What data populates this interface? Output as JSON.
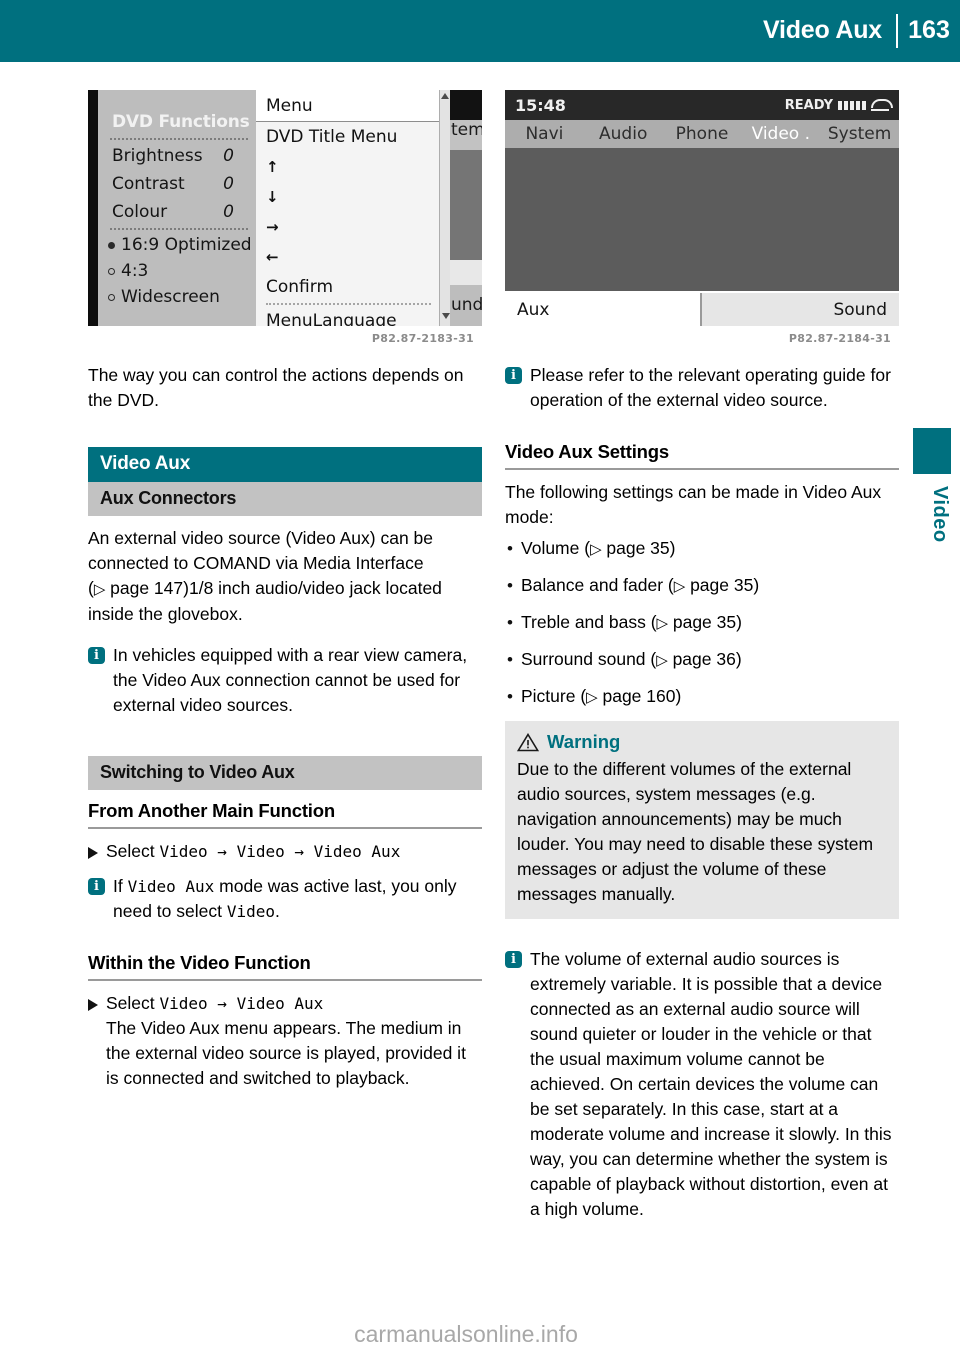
{
  "header": {
    "title": "Video Aux",
    "page_number": "163"
  },
  "edge_tab": {
    "label": "Video",
    "color": "#00707f"
  },
  "figures": {
    "left": {
      "caption": "P82.87-2183-31",
      "left_panel": {
        "title": "DVD Functions",
        "rows": [
          {
            "label": "Brightness",
            "value": "0"
          },
          {
            "label": "Contrast",
            "value": "0"
          },
          {
            "label": "Colour",
            "value": "0"
          }
        ],
        "options": [
          {
            "label": "16:9 Optimized",
            "selected": true
          },
          {
            "label": "4:3",
            "selected": false
          },
          {
            "label": "Widescreen",
            "selected": false
          }
        ]
      },
      "menu_panel": {
        "header": "Menu",
        "items": [
          "DVD Title Menu",
          "↑",
          "↓",
          "→",
          "←",
          "Confirm",
          "MenuLanguage"
        ]
      },
      "right_edge": {
        "top_label": "tem",
        "bottom_label": "und"
      }
    },
    "right": {
      "caption": "P82.87-2184-31",
      "status": {
        "time": "15:48",
        "ready_label": "READY",
        "signal_bars": 5
      },
      "menu_items": [
        "Navi",
        "Audio",
        "Phone",
        "Video .",
        "System"
      ],
      "active_menu_item": "Video .",
      "footer_left": "Aux",
      "footer_right": "Sound"
    }
  },
  "left_column": {
    "intro": "The way you can control the actions depends on the DVD.",
    "section_bar": "Video Aux",
    "subsection_bar": "Aux Connectors",
    "aux_connectors_text_1": "An external video source (Video Aux) can be connected to COMAND via Media Interface (",
    "aux_connectors_ref": "page 147",
    "aux_connectors_text_2": ")1/8 inch audio/video jack located inside the glovebox.",
    "note_1": "In vehicles equipped with a rear view camera, the Video Aux connection cannot be used for external video sources.",
    "switching_bar": "Switching to Video Aux",
    "heading_from_another": "From Another Main Function",
    "step_1_prefix": "Select ",
    "step_1_path": "Video → Video → Video Aux",
    "note_2_a": "If ",
    "note_2_mono": "Video Aux",
    "note_2_b": " mode was active last, you only need to select ",
    "note_2_mono2": "Video",
    "note_2_c": ".",
    "heading_within": "Within the Video Function",
    "step_2_prefix": "Select ",
    "step_2_path": "Video → Video Aux",
    "step_2_detail": "The Video Aux menu appears. The medium in the external video source is played, provided it is connected and switched to playback."
  },
  "right_column": {
    "note_1": "Please refer to the relevant operating guide for operation of the external video source.",
    "heading_settings": "Video Aux Settings",
    "settings_intro": "The following settings can be made in Video Aux mode:",
    "settings_list": [
      {
        "label": "Volume",
        "ref": "page 35"
      },
      {
        "label": "Balance and fader",
        "ref": "page 35"
      },
      {
        "label": "Treble and bass",
        "ref": "page 35"
      },
      {
        "label": "Surround sound",
        "ref": "page 36"
      },
      {
        "label": "Picture",
        "ref": "page 160"
      }
    ],
    "warning": {
      "title": "Warning",
      "text": "Due to the different volumes of the external audio sources, system messages (e.g. navigation announcements) may be much louder. You may need to disable these system messages or adjust the volume of these messages manually."
    },
    "note_2": "The volume of external audio sources is extremely variable. It is possible that a device connected as an external audio source will sound quieter or louder in the vehicle or that the usual maximum volume cannot be achieved. On certain devices the volume can be set separately. In this case, start at a moderate volume and increase it slowly. In this way, you can determine whether the system is capable of playback without distortion, even at a high volume."
  },
  "watermark": "carmanualsonline.info",
  "colors": {
    "accent": "#00707f",
    "gray_bar": "#c2c2c2",
    "warn_bg": "#e6e6e6"
  }
}
